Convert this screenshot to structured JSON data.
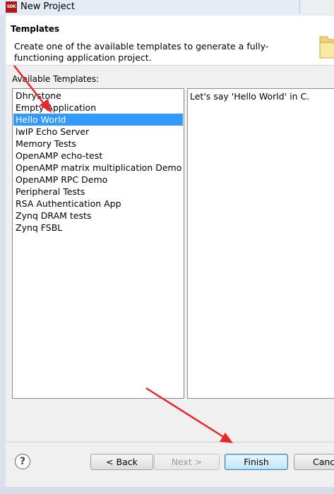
{
  "window": {
    "icon_text": "SDK",
    "title": "New Project"
  },
  "header": {
    "title": "Templates",
    "description": "Create one of the available templates to generate a fully-functioning application project."
  },
  "templates": {
    "label": "Available Templates:",
    "items": [
      "Dhrystone",
      "Empty Application",
      "Hello World",
      "lwIP Echo Server",
      "Memory Tests",
      "OpenAMP echo-test",
      "OpenAMP matrix multiplication Demo",
      "OpenAMP RPC Demo",
      "Peripheral Tests",
      "RSA Authentication App",
      "Zynq DRAM tests",
      "Zynq FSBL"
    ],
    "selected": "Hello World"
  },
  "description_panel": {
    "text": "Let's say 'Hello World' in C."
  },
  "footer": {
    "help_glyph": "?",
    "back_label": "< Back",
    "next_label": "Next >",
    "finish_label": "Finish",
    "cancel_label": "Cancel"
  },
  "annotation_color": "#e8262d"
}
